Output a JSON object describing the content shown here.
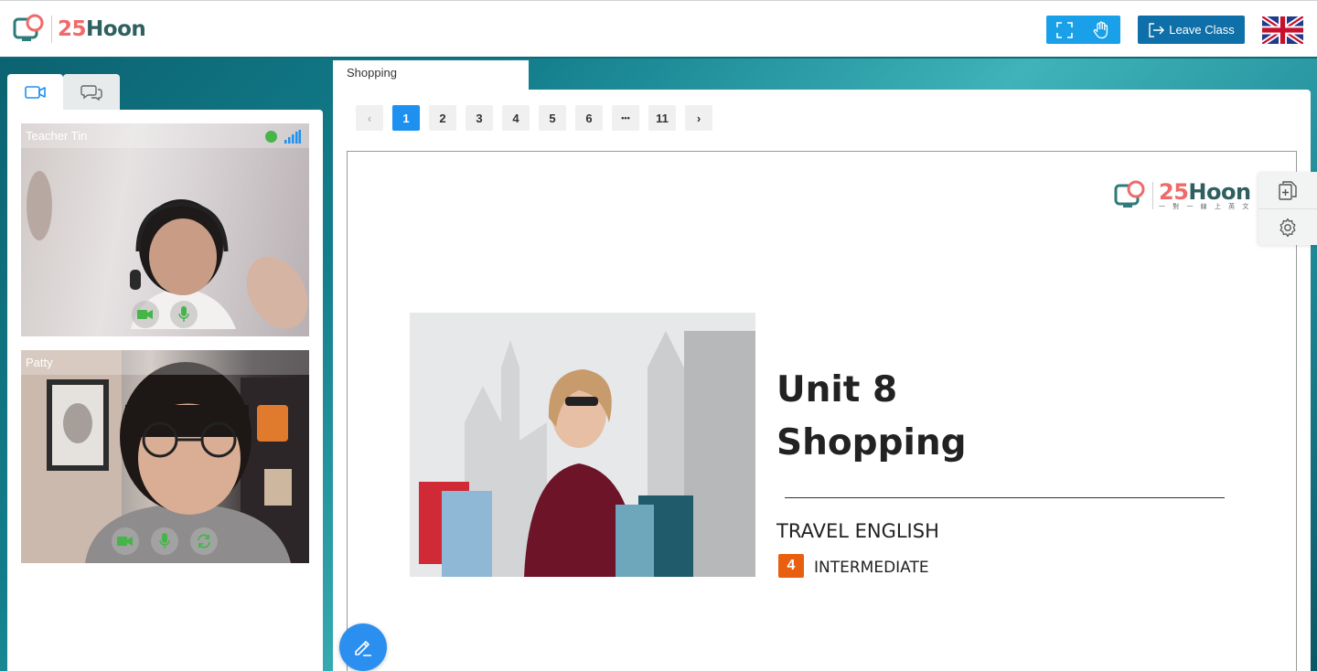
{
  "header": {
    "logo": {
      "number": "25",
      "word": "Hoon"
    },
    "tools": [
      {
        "icon": "fullscreen-icon"
      },
      {
        "icon": "hand-icon"
      }
    ],
    "leave_label": "Leave Class",
    "language_flag": "uk-flag-icon"
  },
  "sidebar": {
    "tabs": [
      {
        "icon": "video-camera-icon",
        "active": true
      },
      {
        "icon": "chat-icon",
        "active": false
      }
    ],
    "videos": [
      {
        "name": "Teacher Tin",
        "status_color": "#45b54a"
      },
      {
        "name": "Patty"
      }
    ]
  },
  "lesson": {
    "tab_label": "Shopping",
    "pagination": {
      "prev": "‹",
      "pages": [
        "1",
        "2",
        "3",
        "4",
        "5",
        "6",
        "•••",
        "11"
      ],
      "current": "1",
      "next": "›"
    },
    "slide": {
      "logo": {
        "number": "25",
        "word": "Hoon",
        "tagline": "一 對 一 線 上 英 文"
      },
      "title_line1": "Unit 8",
      "title_line2": "Shopping",
      "subtitle": "TRAVEL ENGLISH",
      "level_number": "4",
      "level_label": "INTERMEDIATE"
    }
  },
  "colors": {
    "accent": "#1aa0e8",
    "leave_button": "#0f6fa8",
    "page_active": "#1e90f0",
    "level_badge": "#e8600f",
    "logo_number": "#ef6a6a",
    "logo_word": "#2f5f5f"
  }
}
